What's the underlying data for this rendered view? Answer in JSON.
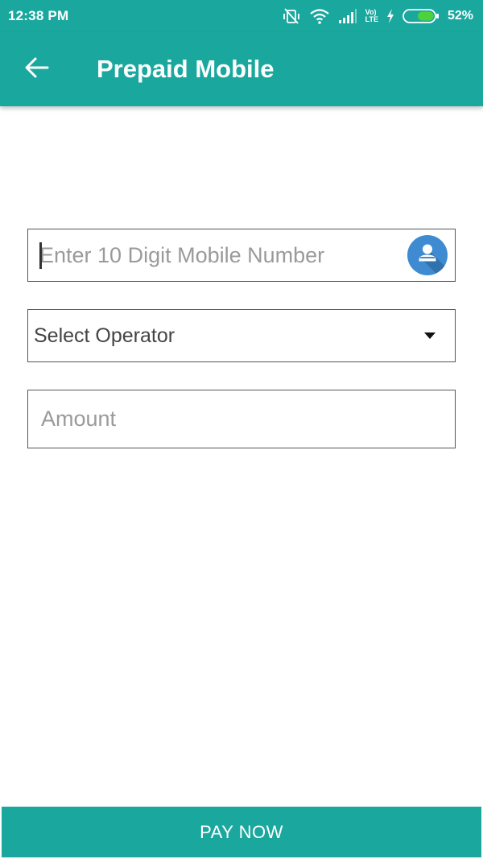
{
  "status_bar": {
    "time": "12:38 PM",
    "battery_percent": "52%",
    "icons": [
      "vibrate-off-icon",
      "wifi-icon",
      "signal-icon",
      "volte-icon",
      "charging-icon",
      "battery-icon"
    ],
    "volte_label_top": "Vo)",
    "volte_label_bottom": "LTE"
  },
  "app_bar": {
    "title": "Prepaid Mobile",
    "back_icon": "arrow-left-icon"
  },
  "form": {
    "mobile_placeholder": "Enter 10 Digit Mobile Number",
    "contact_icon": "contact-picker-icon",
    "operator_label": "Select Operator",
    "operator_icon": "caret-down-icon",
    "amount_placeholder": "Amount"
  },
  "footer": {
    "pay_label": "PAY NOW"
  },
  "colors": {
    "primary": "#1aa89e",
    "contact_button": "#3e8bd2",
    "border": "#555555",
    "placeholder": "#9a9a9a"
  }
}
